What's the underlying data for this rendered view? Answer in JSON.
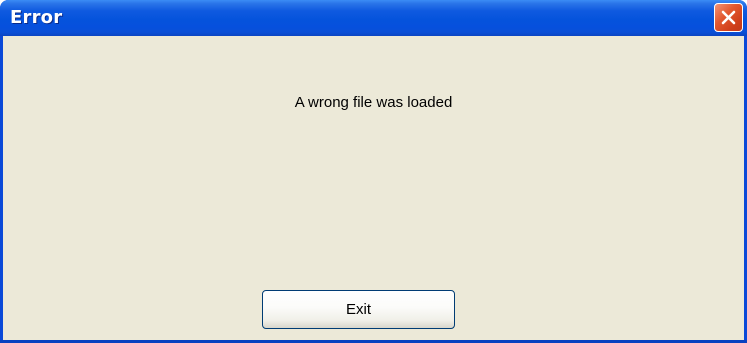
{
  "window": {
    "title": "Error"
  },
  "dialog": {
    "message": "A wrong file was loaded",
    "exit_label": "Exit"
  },
  "icons": {
    "close": "close-icon"
  },
  "colors": {
    "titlebar": "#0553dc",
    "client_background": "#ece9d8",
    "close_button": "#e2582f"
  }
}
